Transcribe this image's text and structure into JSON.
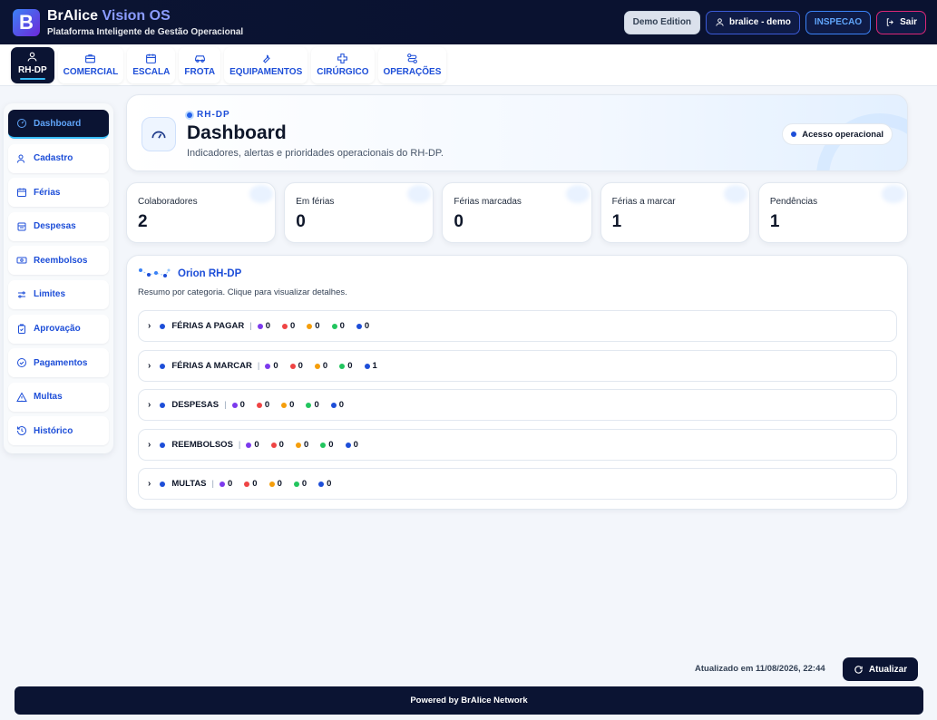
{
  "header": {
    "logo_letter": "B",
    "title_main": "BrAlice",
    "title_accent": "Vision OS",
    "subtitle": "Plataforma Inteligente de Gestão Operacional",
    "demo_label": "Demo Edition",
    "user_label": "bralice - demo",
    "inspecao_label": "INSPECAO",
    "exit_label": "Sair"
  },
  "modules": [
    {
      "label": "RH-DP",
      "icon": "users-icon"
    },
    {
      "label": "COMERCIAL",
      "icon": "briefcase-icon"
    },
    {
      "label": "ESCALA",
      "icon": "calendar-icon"
    },
    {
      "label": "FROTA",
      "icon": "car-icon"
    },
    {
      "label": "EQUIPAMENTOS",
      "icon": "wrench-icon"
    },
    {
      "label": "CIRÚRGICO",
      "icon": "cross-icon"
    },
    {
      "label": "OPERAÇÕES",
      "icon": "route-icon"
    }
  ],
  "sidebar": {
    "items": [
      {
        "label": "Dashboard",
        "icon": "gauge-icon"
      },
      {
        "label": "Cadastro",
        "icon": "user-icon"
      },
      {
        "label": "Férias",
        "icon": "calendar-icon"
      },
      {
        "label": "Despesas",
        "icon": "receipt-icon"
      },
      {
        "label": "Reembolsos",
        "icon": "money-icon"
      },
      {
        "label": "Limites",
        "icon": "sliders-icon"
      },
      {
        "label": "Aprovação",
        "icon": "clipboard-check-icon"
      },
      {
        "label": "Pagamentos",
        "icon": "check-circle-icon"
      },
      {
        "label": "Multas",
        "icon": "warning-icon"
      },
      {
        "label": "Histórico",
        "icon": "history-icon"
      }
    ]
  },
  "dashboard": {
    "kicker": "RH-DP",
    "title": "Dashboard",
    "subtitle": "Indicadores, alertas e prioridades operacionais do RH-DP.",
    "access_label": "Acesso operacional"
  },
  "stats": [
    {
      "label": "Colaboradores",
      "value": "2"
    },
    {
      "label": "Em férias",
      "value": "0"
    },
    {
      "label": "Férias marcadas",
      "value": "0"
    },
    {
      "label": "Férias a marcar",
      "value": "1"
    },
    {
      "label": "Pendências",
      "value": "1"
    }
  ],
  "orion": {
    "title": "Orion RH-DP",
    "subtitle": "Resumo por categoria. Clique para visualizar detalhes.",
    "dot_colors": [
      "#7c3aed",
      "#ef4444",
      "#f59e0b",
      "#22c55e",
      "#1d4ed8"
    ],
    "categories": [
      {
        "name": "FÉRIAS A PAGAR",
        "counts": [
          "0",
          "0",
          "0",
          "0",
          "0"
        ]
      },
      {
        "name": "FÉRIAS A MARCAR",
        "counts": [
          "0",
          "0",
          "0",
          "0",
          "1"
        ]
      },
      {
        "name": "DESPESAS",
        "counts": [
          "0",
          "0",
          "0",
          "0",
          "0"
        ]
      },
      {
        "name": "REEMBOLSOS",
        "counts": [
          "0",
          "0",
          "0",
          "0",
          "0"
        ]
      },
      {
        "name": "MULTAS",
        "counts": [
          "0",
          "0",
          "0",
          "0",
          "0"
        ]
      }
    ]
  },
  "footer": {
    "updated_label": "Atualizado em 11/08/2026, 22:44",
    "refresh_label": "Atualizar",
    "powered": "Powered by BrAlice Network"
  }
}
